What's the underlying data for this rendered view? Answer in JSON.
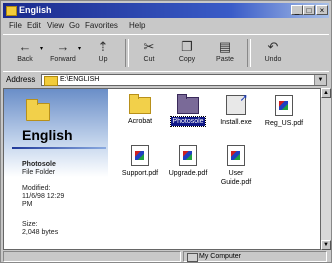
{
  "window": {
    "title": "English"
  },
  "menu": [
    "File",
    "Edit",
    "View",
    "Go",
    "Favorites",
    "Help"
  ],
  "toolbar": {
    "back": "Back",
    "forward": "Forward",
    "up": "Up",
    "cut": "Cut",
    "copy": "Copy",
    "paste": "Paste",
    "undo": "Undo"
  },
  "address": {
    "label": "Address",
    "value": "E:\\ENGLISH"
  },
  "left_pane": {
    "title": "English",
    "item_name": "Photosole",
    "item_type": "File Folder",
    "modified_label": "Modified:",
    "modified_value": "11/6/98 12:29 PM",
    "size_label": "Size:",
    "size_value": "2,048 bytes"
  },
  "files": [
    {
      "name": "Acrobat",
      "kind": "folder",
      "selected": false
    },
    {
      "name": "Photosole",
      "kind": "folder",
      "selected": true
    },
    {
      "name": "Install.exe",
      "kind": "exe",
      "selected": false
    },
    {
      "name": "Reg_US.pdf",
      "kind": "pdf",
      "selected": false
    },
    {
      "name": "Support.pdf",
      "kind": "pdf",
      "selected": false
    },
    {
      "name": "Upgrade.pdf",
      "kind": "pdf",
      "selected": false
    },
    {
      "name": "User Guide.pdf",
      "kind": "pdf",
      "selected": false
    }
  ],
  "status": {
    "location": "My Computer"
  },
  "colors": {
    "title_bar": "#1a2a8c",
    "selection": "#101888",
    "folder": "#f2d04a"
  }
}
